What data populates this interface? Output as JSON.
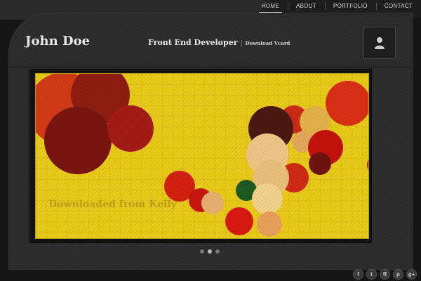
{
  "nav": {
    "items": [
      {
        "label": "HOME",
        "active": true
      },
      {
        "label": "ABOUT",
        "active": false
      },
      {
        "label": "PORTFOLIO",
        "active": false
      },
      {
        "label": "CONTACT",
        "active": false
      }
    ]
  },
  "header": {
    "name": "John Doe",
    "role": "Front End Developer",
    "separator": "|",
    "vcard_link": "Download Vcard"
  },
  "slider": {
    "watermark": "Downloaded from Kelly",
    "background_color": "#eacb1a",
    "dots": [
      {
        "active": false
      },
      {
        "active": true
      },
      {
        "active": false
      }
    ]
  },
  "social": {
    "icons": [
      {
        "name": "facebook-icon",
        "glyph": "f"
      },
      {
        "name": "twitter-icon",
        "glyph": "t"
      },
      {
        "name": "flickr-icon",
        "glyph": "ff"
      },
      {
        "name": "pinterest-icon",
        "glyph": "p"
      },
      {
        "name": "googleplus-icon",
        "glyph": "g+"
      }
    ]
  }
}
